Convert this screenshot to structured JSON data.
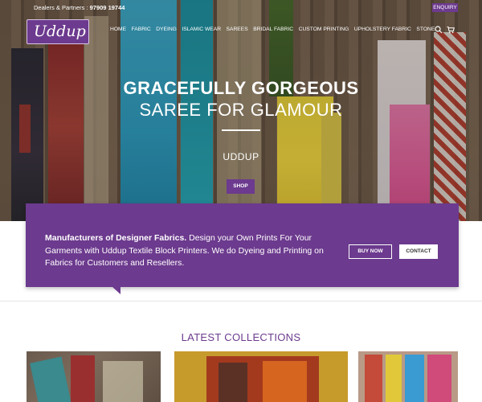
{
  "topbar": {
    "dealers_label": "Dealers & Partners :",
    "phone": "97909 19744",
    "enquiry": "ENQUIRY"
  },
  "logo": {
    "text": "Uddup"
  },
  "nav": [
    "HOME",
    "FABRIC",
    "DYEING",
    "ISLAMIC WEAR",
    "SAREES",
    "BRIDAL FABRIC",
    "CUSTOM PRINTING",
    "UPHOLSTERY FABRIC",
    "STONE"
  ],
  "hero": {
    "line1": "GRACEFULLY GORGEOUS",
    "line2": "SAREE FOR GLAMOUR",
    "line3": "UDDUP",
    "shop": "SHOP"
  },
  "promo": {
    "bold": "Manufacturers of Designer Fabrics.",
    "text": " Design your Own Prints For Your Garments with Uddup Textile Block Printers. We do Dyeing and Printing on Fabrics for Customers and Resellers.",
    "buy_now": "BUY NOW",
    "contact": "CONTACT"
  },
  "latest": {
    "title": "LATEST COLLECTIONS"
  },
  "icons": {
    "search": "search-icon",
    "cart": "cart-icon"
  },
  "colors": {
    "accent": "#6c3a8e"
  }
}
